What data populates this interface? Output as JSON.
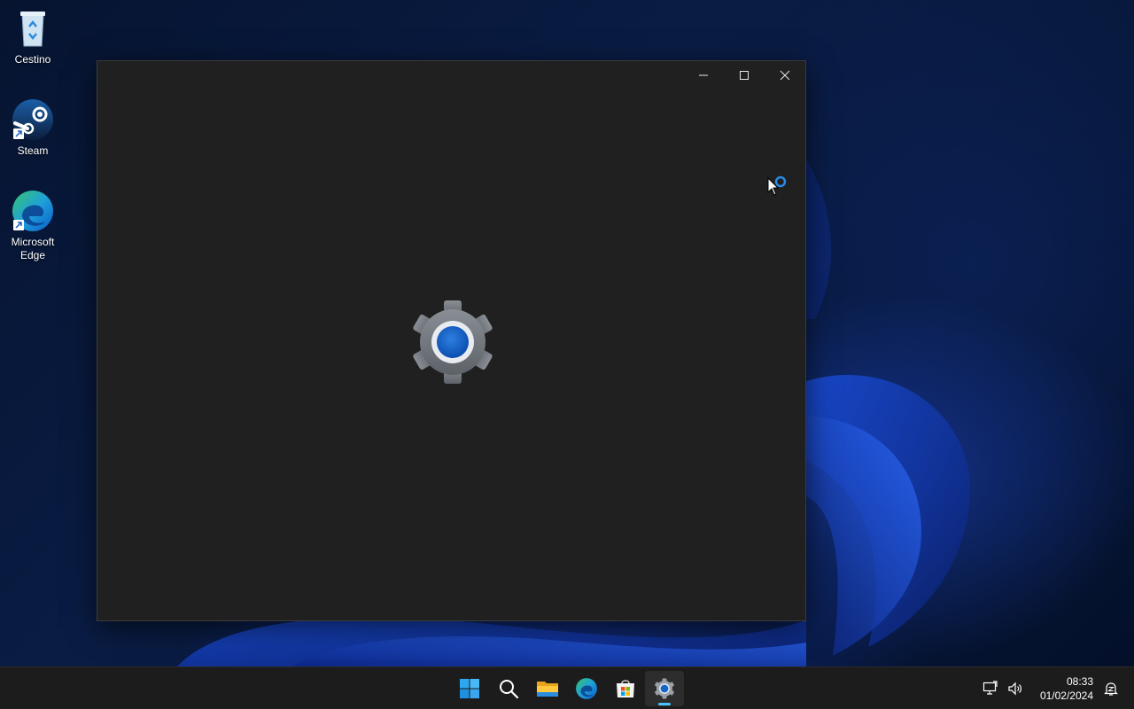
{
  "desktop": {
    "icons": [
      {
        "label": "Cestino",
        "icon": "recycle-bin-icon"
      },
      {
        "label": "Steam",
        "icon": "steam-icon"
      },
      {
        "label": "Microsoft\nEdge",
        "icon": "edge-icon"
      }
    ]
  },
  "window": {
    "app_icon": "settings-gear-icon",
    "controls": [
      "minimize-icon",
      "maximize-icon",
      "close-icon"
    ],
    "background": "#202020"
  },
  "cursor": {
    "state": "busy",
    "icon": "busy-cursor-icon"
  },
  "taskbar": {
    "apps": [
      {
        "name": "start",
        "icon": "windows-logo-icon",
        "active": false
      },
      {
        "name": "search",
        "icon": "search-icon",
        "active": false
      },
      {
        "name": "file-explorer",
        "icon": "folder-icon",
        "active": false
      },
      {
        "name": "edge",
        "icon": "edge-icon",
        "active": false
      },
      {
        "name": "store",
        "icon": "store-icon",
        "active": false
      },
      {
        "name": "settings",
        "icon": "settings-gear-icon",
        "active": true
      }
    ],
    "tray": {
      "icons": [
        "network-icon",
        "volume-icon",
        "notification-icon"
      ],
      "time": "08:33",
      "date": "01/02/2024"
    },
    "accent_color": "#4cc2ff"
  }
}
